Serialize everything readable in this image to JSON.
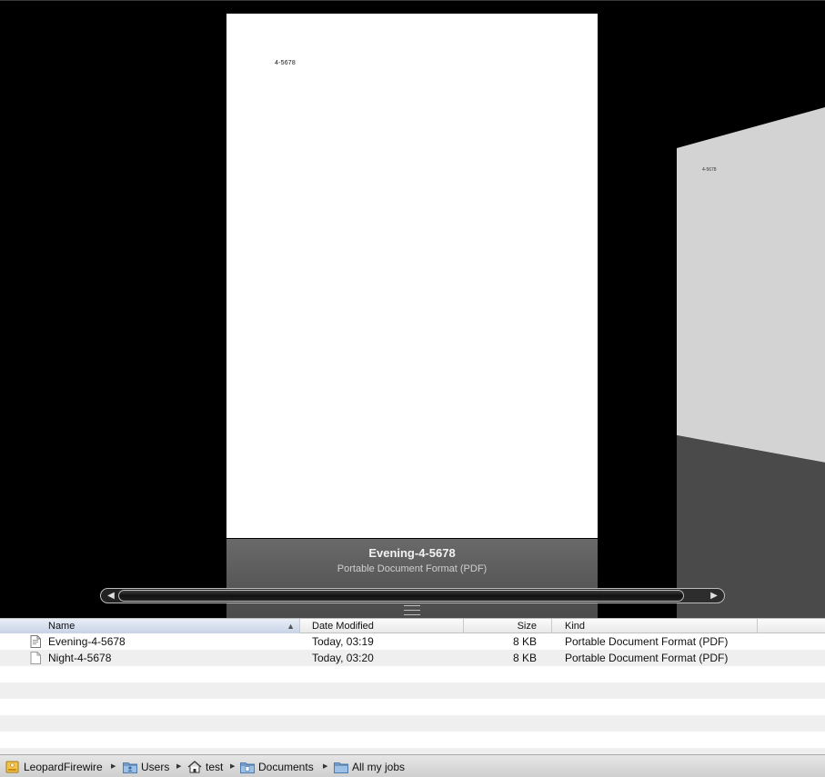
{
  "coverflow": {
    "center_page_text": "4-5678",
    "side_page_text": "4-5678",
    "selected_title": "Evening-4-5678",
    "selected_kind": "Portable Document Format (PDF)"
  },
  "list": {
    "columns": {
      "name": "Name",
      "date": "Date Modified",
      "size": "Size",
      "kind": "Kind"
    },
    "sort": {
      "column": "name",
      "direction": "ascending"
    },
    "rows": [
      {
        "name": "Evening-4-5678",
        "date": "Today, 03:19",
        "size": "8 KB",
        "kind": "Portable Document Format (PDF)",
        "icon": "pdf-document-icon"
      },
      {
        "name": "Night-4-5678",
        "date": "Today, 03:20",
        "size": "8 KB",
        "kind": "Portable Document Format (PDF)",
        "icon": "blank-document-icon"
      }
    ]
  },
  "pathbar": {
    "items": [
      {
        "label": "LeopardFirewire",
        "icon": "firewire-drive-icon"
      },
      {
        "label": "Users",
        "icon": "users-folder-icon"
      },
      {
        "label": "test",
        "icon": "home-icon"
      },
      {
        "label": "Documents",
        "icon": "documents-folder-icon"
      },
      {
        "label": "All my jobs",
        "icon": "folder-icon"
      }
    ]
  },
  "colors": {
    "coverflow_bg": "#000000",
    "reflection": "#5a5a5a",
    "selected_header": "#c7d3e6",
    "alt_row": "#efefef"
  }
}
